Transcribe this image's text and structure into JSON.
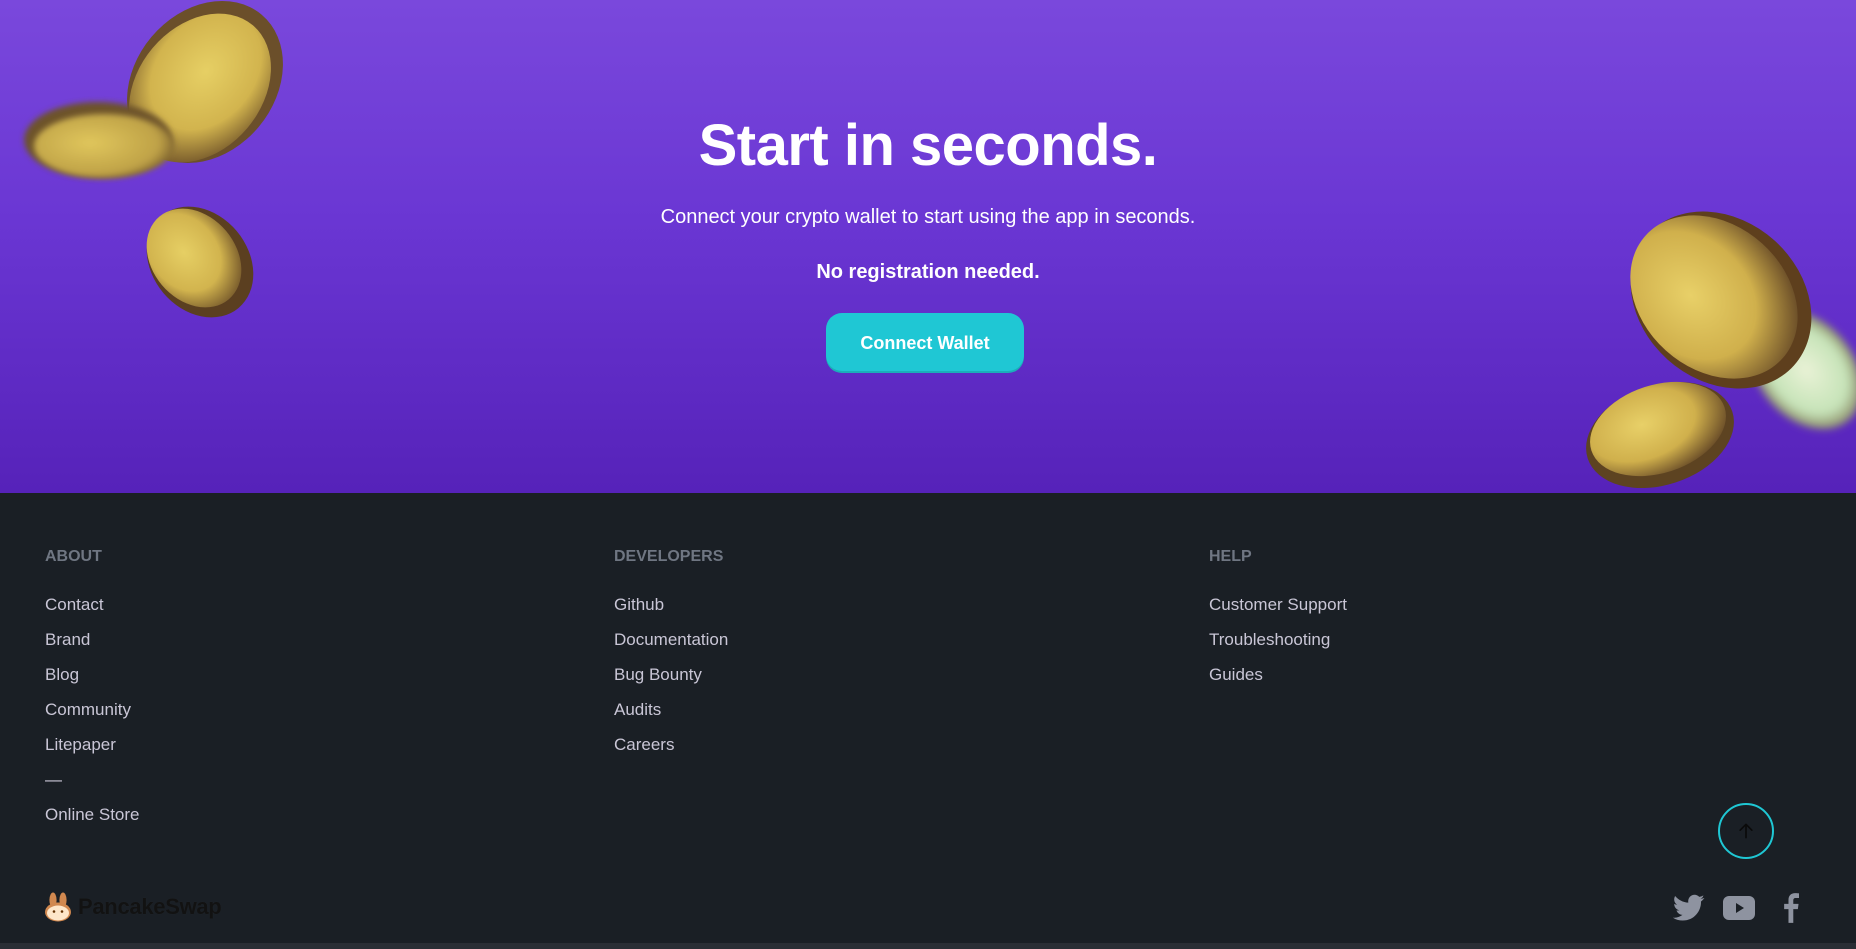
{
  "hero": {
    "title": "Start in seconds.",
    "subtitle": "Connect your crypto wallet to start using the app in seconds.",
    "note": "No registration needed.",
    "cta_label": "Connect Wallet"
  },
  "footer": {
    "columns": [
      {
        "title": "ABOUT",
        "links": [
          "Contact",
          "Brand",
          "Blog",
          "Community",
          "Litepaper",
          "—",
          "Online Store"
        ]
      },
      {
        "title": "DEVELOPERS",
        "links": [
          "Github",
          "Documentation",
          "Bug Bounty",
          "Audits",
          "Careers"
        ]
      },
      {
        "title": "HELP",
        "links": [
          "Customer Support",
          "Troubleshooting",
          "Guides"
        ]
      }
    ],
    "brand_name": "PancakeSwap",
    "social_icons": [
      "twitter-icon",
      "youtube-icon",
      "facebook-icon"
    ],
    "back_to_top_icon": "arrow-up-icon"
  },
  "colors": {
    "hero_top": "#7a48dc",
    "hero_bottom": "#5622b9",
    "accent": "#1fc7d4",
    "footer_bg": "#1a1f25",
    "footer_heading": "#6f7682",
    "footer_link": "#c9c6d6",
    "social_icon": "#8e93a0"
  }
}
